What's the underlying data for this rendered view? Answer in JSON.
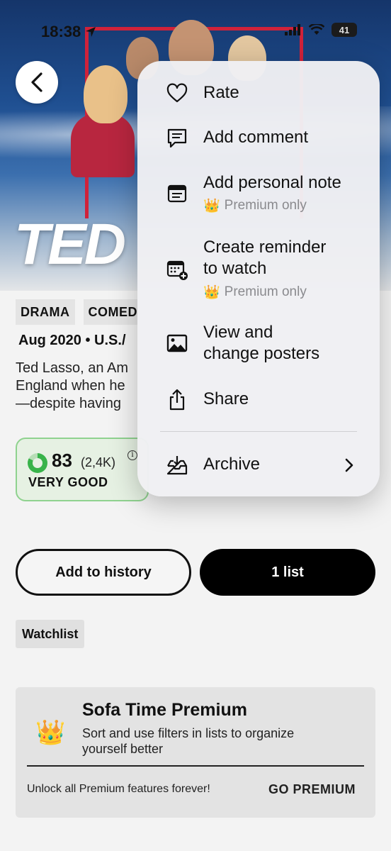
{
  "status": {
    "time": "18:38",
    "battery": "41"
  },
  "hero": {
    "title_text": "TED"
  },
  "show": {
    "genres": [
      "DRAMA",
      "COMED"
    ],
    "meta": "Aug 2020 • U.S./",
    "description_lines": [
      "Ted Lasso, an Am",
      "England when he",
      "—despite having"
    ]
  },
  "rating": {
    "score": "83",
    "count": "(2,4K)",
    "label": "VERY GOOD",
    "info": "i",
    "fraction": 0.83
  },
  "menu": {
    "items": [
      {
        "label": "Rate",
        "icon": "heart-icon"
      },
      {
        "label": "Add comment",
        "icon": "comment-icon"
      },
      {
        "label": "Add personal note",
        "sub": "Premium only",
        "icon": "note-icon"
      },
      {
        "label": "Create reminder to watch",
        "label_line1": "Create reminder",
        "label_line2": "to watch",
        "sub": "Premium only",
        "icon": "calendar-add-icon"
      },
      {
        "label": "View and change posters",
        "label_line1": "View and",
        "label_line2": "change posters",
        "icon": "image-icon"
      },
      {
        "label": "Share",
        "icon": "share-icon"
      },
      {
        "label": "Archive",
        "icon": "archive-icon"
      }
    ]
  },
  "actions": {
    "history": "Add to history",
    "list": "1 list",
    "watchlist": "Watchlist"
  },
  "premium": {
    "title": "Sofa Time Premium",
    "subtitle": "Sort and use filters in lists to organize yourself better",
    "unlock": "Unlock all Premium features forever!",
    "cta": "GO PREMIUM"
  },
  "colors": {
    "accent_green": "#38b34a",
    "rating_border": "#8fd28f",
    "frame_red": "#d0223a"
  }
}
